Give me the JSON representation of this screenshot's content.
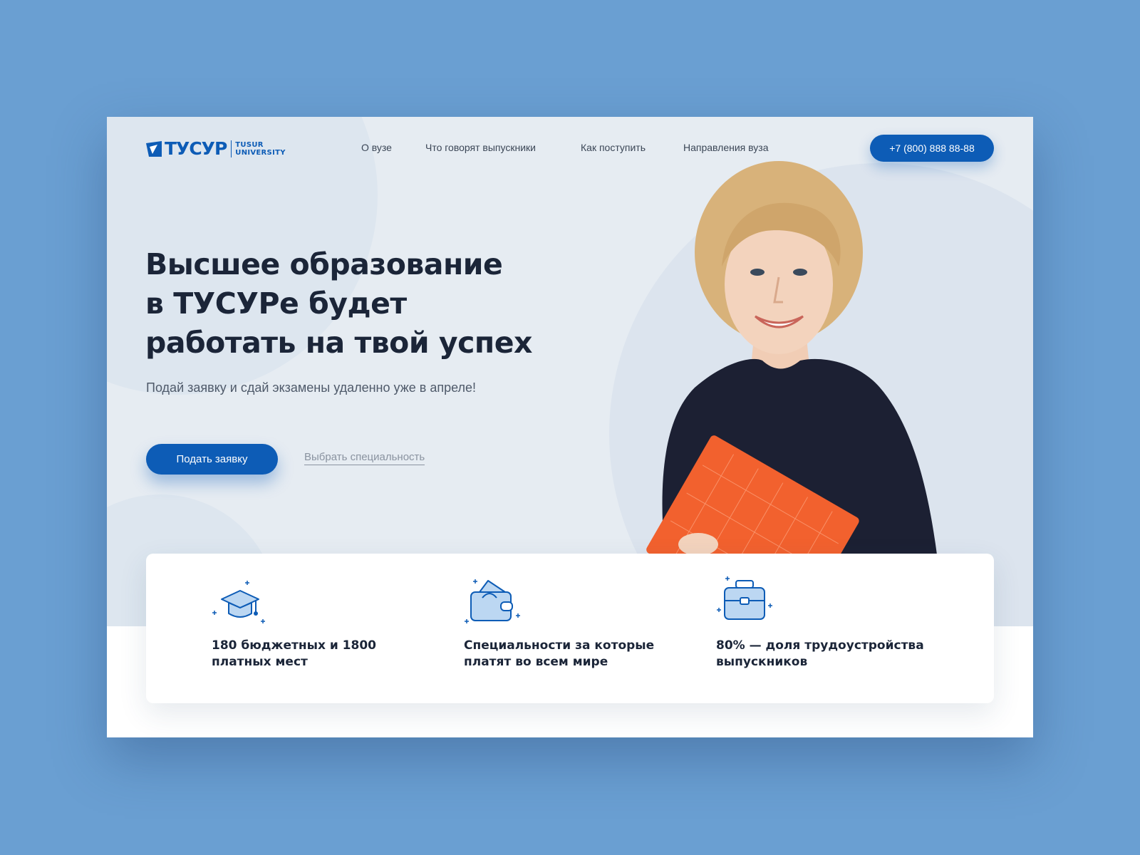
{
  "brand": {
    "logo_main": "ТУСУР",
    "logo_sub_line1": "TUSUR",
    "logo_sub_line2": "UNIVERSITY"
  },
  "nav": {
    "items": [
      {
        "label": "О вузе"
      },
      {
        "label": "Что говорят выпускники"
      },
      {
        "label": "Как поступить"
      },
      {
        "label": "Направления вуза"
      }
    ],
    "phone": "+7 (800) 888 88-88"
  },
  "hero": {
    "headline_line1": "Высшее образование",
    "headline_line2": "в ТУСУРе будет",
    "headline_line3": "работать на твой успех",
    "subline": "Подай заявку и сдай экзамены удаленно уже в апреле!",
    "cta_label": "Подать заявку",
    "secondary_link": "Выбрать специальность"
  },
  "features": [
    {
      "icon": "graduation-cap-icon",
      "line1": "180 бюджетных и 1800",
      "line2": "платных мест"
    },
    {
      "icon": "wallet-icon",
      "line1": "Специальности за которые",
      "line2": "платят во всем мире"
    },
    {
      "icon": "briefcase-icon",
      "line1": "80% — доля трудоустройства",
      "line2": "выпускников"
    }
  ],
  "colors": {
    "page_background": "#6a9fd2",
    "hero_background": "#e6ecf2",
    "accent": "#0d5cb6",
    "heading": "#1b2538",
    "folder": "#f2612e"
  }
}
